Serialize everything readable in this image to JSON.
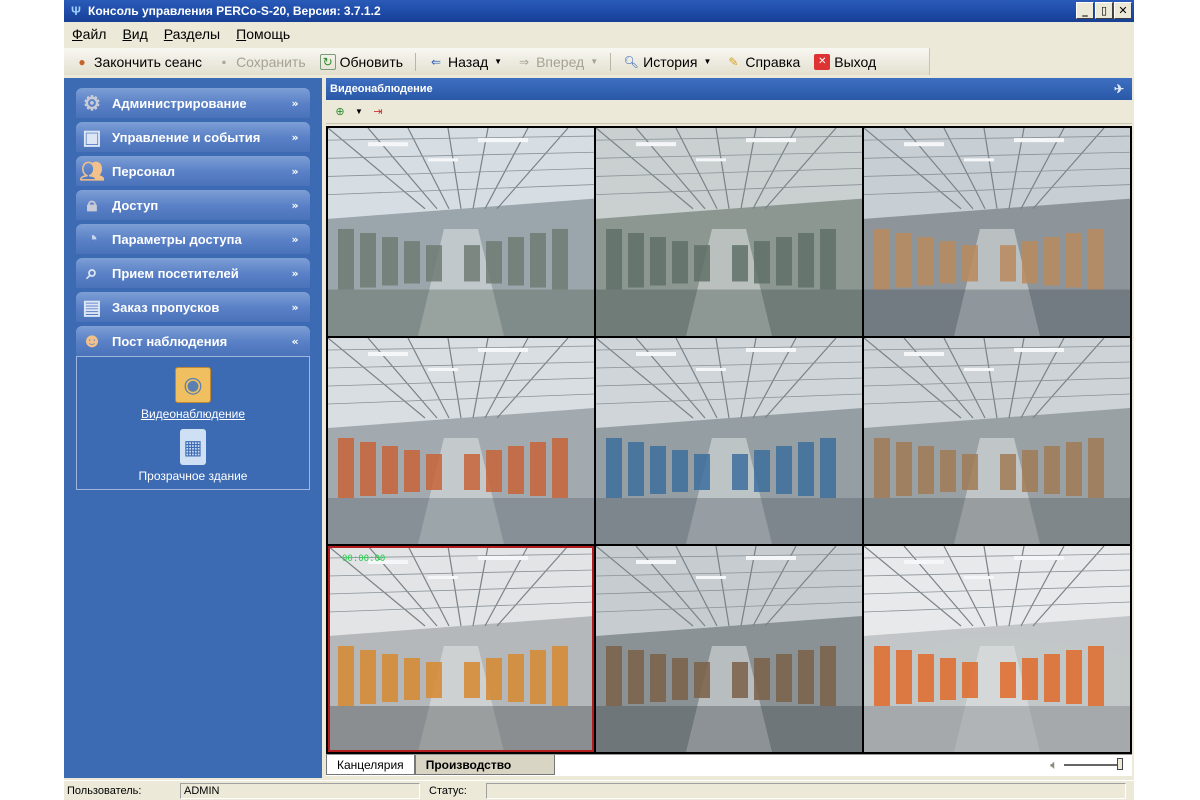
{
  "window": {
    "title": "Консоль управления PERCo-S-20, Версия: 3.7.1.2",
    "icon": "perco-logo-icon",
    "buttons": {
      "minimize": "_",
      "maximize": "▯",
      "close": "✕"
    }
  },
  "menu": {
    "items": [
      "Файл",
      "Вид",
      "Разделы",
      "Помощь"
    ]
  },
  "toolbar": {
    "end_session": "Закончить сеанс",
    "save": "Сохранить",
    "refresh": "Обновить",
    "back": "Назад",
    "forward": "Вперед",
    "history": "История",
    "help": "Справка",
    "exit": "Выход"
  },
  "sidebar": {
    "items": [
      {
        "label": "Администрирование",
        "icon": "gear-icon",
        "expanded": false
      },
      {
        "label": "Управление и события",
        "icon": "monitor-icon",
        "expanded": false
      },
      {
        "label": "Персонал",
        "icon": "people-icon",
        "expanded": false
      },
      {
        "label": "Доступ",
        "icon": "lock-icon",
        "expanded": false
      },
      {
        "label": "Параметры доступа",
        "icon": "pie-icon",
        "expanded": false
      },
      {
        "label": "Прием посетителей",
        "icon": "visitor-icon",
        "expanded": false
      },
      {
        "label": "Заказ пропусков",
        "icon": "pass-card-icon",
        "expanded": false
      },
      {
        "label": "Пост наблюдения",
        "icon": "operator-icon",
        "expanded": true
      }
    ],
    "panel": {
      "entries": [
        {
          "label": "Видеонаблюдение",
          "icon": "camera-icon",
          "selected": true
        },
        {
          "label": "Прозрачное здание",
          "icon": "building-icon",
          "selected": false
        }
      ]
    }
  },
  "main": {
    "header_title": "Видеонаблюдение",
    "cameras": [
      {
        "scene": "office"
      },
      {
        "scene": "workshop"
      },
      {
        "scene": "assembly"
      },
      {
        "scene": "warehouse"
      },
      {
        "scene": "machines"
      },
      {
        "scene": "production-hall"
      },
      {
        "scene": "racks",
        "osd": "00:00:00",
        "active": true
      },
      {
        "scene": "factory-floor"
      },
      {
        "scene": "turnstiles"
      }
    ],
    "tabs": [
      {
        "label": "Канцелярия",
        "selected": false
      },
      {
        "label": "Производство",
        "selected": true
      }
    ]
  },
  "status": {
    "user_label": "Пользователь:",
    "user_value": "ADMIN",
    "status_label": "Статус:",
    "status_value": ""
  },
  "colors": {
    "titlebar": "#1d4aa6",
    "sidebar": "#3d6bb3",
    "window_bg": "#ece9d8",
    "active_camera_border": "#b31d1d"
  }
}
